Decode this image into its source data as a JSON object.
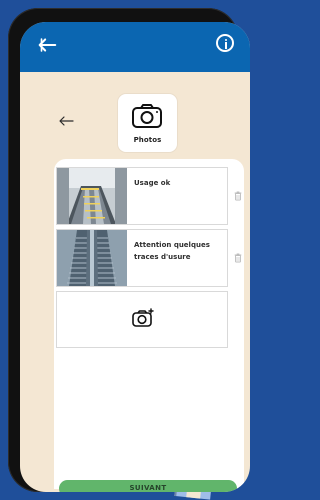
{
  "header": {
    "back_icon": "arrow-left-icon",
    "info_icon": "info-icon"
  },
  "photo_card": {
    "title": "Photos",
    "icon": "camera-icon"
  },
  "nav": {
    "back_icon": "arrow-left-icon"
  },
  "entries": [
    {
      "status_text": "Usage ok",
      "photo": "escalator-photo",
      "delete_icon": "trash-icon"
    },
    {
      "status_text": "Attention quelques traces d'usure",
      "photo": "escalator-photo",
      "delete_icon": "trash-icon"
    }
  ],
  "add_photo": {
    "icon": "add-camera-icon"
  },
  "footer": {
    "next_label": "SUIVANT"
  },
  "colors": {
    "header": "#0b66b1",
    "background": "#f4e7d3",
    "accent": "#61b56b",
    "border": "#d9d9d9"
  }
}
